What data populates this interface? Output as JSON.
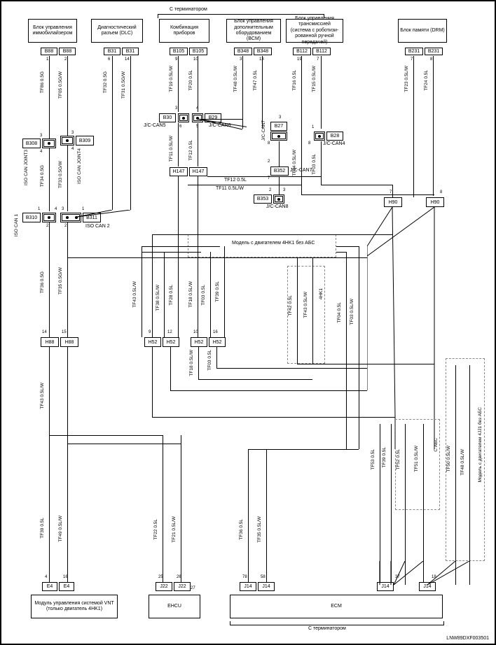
{
  "header": {
    "terminator_top": "С терминатором",
    "terminator_bottom": "С терминатором"
  },
  "top_modules": {
    "m1": "Блок управления иммобилайзером",
    "m2": "Диагностический разъем (DLC)",
    "m3": "Комбинация приборов",
    "m4": "Блок управления дополнительным оборудованием (BCM)",
    "m5": "Блок управления трансмиссией (система с роботизи-рованной ручной передачей)",
    "m6": "Блок памяти (DRM)"
  },
  "bottom_modules": {
    "vnt": "Модуль управления системой VNT (только двигатель 4HK1)",
    "ehcu": "EHCU",
    "ecm": "ECM"
  },
  "connectors": {
    "B88_1": "B88",
    "B88_2": "B88",
    "B31_1": "B31",
    "B31_2": "B31",
    "B105_1": "B105",
    "B105_2": "B105",
    "B348_1": "B348",
    "B348_2": "B348",
    "B112_1": "B112",
    "B112_2": "B112",
    "B231_1": "B231",
    "B231_2": "B231",
    "B308": "B308",
    "B309": "B309",
    "B310": "B310",
    "B311": "B311",
    "B30": "B30",
    "B29": "B29",
    "B27": "B27",
    "B28": "B28",
    "B352": "B352",
    "B353": "B353",
    "H88_1": "H88",
    "H88_2": "H88",
    "H52_1": "H52",
    "H52_2": "H52",
    "H52_3": "H52",
    "H52_4": "H52",
    "H147_1": "H147",
    "H147_2": "H147",
    "H90_1": "H90",
    "H90_2": "H90",
    "J22_1": "J22",
    "J22_2": "J22",
    "J14_1": "J14",
    "J14_2": "J14",
    "J14_3": "J14",
    "J14_4": "J14",
    "E4_1": "E4",
    "E4_2": "E4"
  },
  "labels": {
    "iso_can_joint3": "ISO CAN JOINT3",
    "iso_can_joint4": "ISO CAN JOINT4",
    "iso_can_1": "ISO CAN 1",
    "iso_can_2": "ISO CAN 2",
    "jc_can5": "J/C-CAN5",
    "jc_can6": "J/C-CAN6",
    "jc_can7": "J/C-CAN7",
    "jc_can4": "J/C-CAN4",
    "jc_can8": "J/C-CAN8",
    "model_4hk1_no_abs": "Модель с двигателем 4HK1 без АБС",
    "model_4j1_no_abs": "Модель с двигателем 4JJ1 без АБС",
    "4hk1": "4HK1",
    "c_abs": "С АБС"
  },
  "wires": {
    "tf86": "TF86 0.5G",
    "tf05": "TF05 0.5G/W",
    "tf32": "TF32 0.5G",
    "tf31": "TF31 0.5G/W",
    "tf19": "TF19 0.5L/W",
    "tf20": "TF20 0.5L",
    "tf48": "TF48 0.5L/W",
    "tf47": "TF47 0.5L",
    "tf16": "TF16 0.5L",
    "tf15": "TF15 0.5L/W",
    "tf23": "TF23 0.5L/W",
    "tf24": "TF24 0.5L",
    "tf34": "TF34 0.5G",
    "tf33": "TF33 0.5G/W",
    "tf11_h": "TF11 0.5L/W",
    "tf12_h": "TF12 0.5L",
    "tf11_v": "TF11 0.5L/W",
    "tf12_v": "TF12 0.5L",
    "tf04a": "TF04 0.5L/W",
    "tf03a": "TF03 0.5L",
    "tf04": "TF04 0.5L",
    "tf03": "TF03 0.5L/W",
    "tf36": "TF36 0.5G",
    "tf35": "TF35 0.5G/W",
    "tf43a": "TF43 0.5L/W",
    "tf43b": "TF43 0.5L/W",
    "tf38": "TF38 0.5L/W",
    "tf28": "TF28 0.5L",
    "tf18a": "TF18 0.5L/W",
    "tf18b": "TF18 0.5L/W",
    "tf03b": "TF03 0.5L",
    "tf42": "TF42 0.5L",
    "tf39a": "TF39 0.5L",
    "tf39b": "TF39 0.5L",
    "tf49": "TF49 0.5L/W",
    "tf50": "TF50 0.5L/W",
    "tf51": "TF51 0.5L/W",
    "tf52": "TF52 0.5L",
    "tf53": "TF53 0.5L",
    "tf48b": "TF48 0.5L/W",
    "tf39c": "TF39 0.5L",
    "tf22": "TF22 0.5L",
    "tf21": "TF21 0.5L/W",
    "tf36b": "TF36 0.5L",
    "tf35b": "TF35 0.5L/W"
  },
  "pins": {
    "p1": "1",
    "p2": "2",
    "p3": "3",
    "p4": "4",
    "p5": "5",
    "p6": "6",
    "p7": "7",
    "p8": "8",
    "p9": "9",
    "p10": "10",
    "p12": "12",
    "p13": "13",
    "p14": "14",
    "p15": "15",
    "p16": "16",
    "p18": "18",
    "p19": "19",
    "p25": "25",
    "p26": "26",
    "p27": "27",
    "p37": "37",
    "p58": "58",
    "p78": "78"
  },
  "footer": "LNW89DXF003501"
}
